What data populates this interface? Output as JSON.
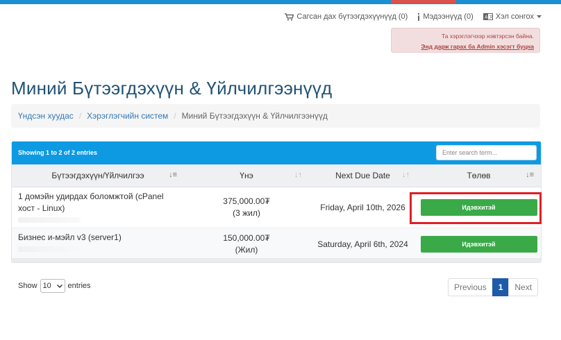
{
  "topnav": {
    "cart_label": "Сагсан дах бүтээгдэхүүнүүд (0)",
    "notifications_label": "Мэдээнүүд (0)",
    "language_label": "Хэл сонгох"
  },
  "admin_alert": {
    "message": "Та хэрэглэгчээр нэвтэрсэн байна.",
    "link": "Энд дарж гарах ба Admin хэсэгт буцна"
  },
  "page": {
    "title": "Миний Бүтээгдэхүүн & Үйлчилгээнүүд"
  },
  "breadcrumb": {
    "items": [
      "Үндсэн хуудас",
      "Хэрэглэгчийн систем",
      "Миний Бүтээгдэхүүн & Үйлчилгээнүүд"
    ]
  },
  "table": {
    "info": "Showing 1 to 2 of 2 entries",
    "search_placeholder": "Enter search term...",
    "headers": [
      "Бүтээгдэхүүн/Үйлчилгээ",
      "Үнэ",
      "Next Due Date",
      "Төлөв"
    ],
    "rows": [
      {
        "product": "1 домэйн удирдах боломжтой (cPanel хост - Linux)",
        "price": "375,000.00₮",
        "cycle": "(3 жил)",
        "due": "Friday, April 10th, 2026",
        "status": "Идэвхитэй"
      },
      {
        "product": "Бизнес и-мэйл v3 (server1)",
        "price": "150,000.00₮",
        "cycle": "(Жил)",
        "due": "Saturday, April 6th, 2024",
        "status": "Идэвхитэй"
      }
    ]
  },
  "footer": {
    "show_label": "Show",
    "entries_value": "10",
    "entries_label": "entries"
  },
  "pagination": {
    "previous": "Previous",
    "current": "1",
    "next": "Next"
  },
  "colors": {
    "topbar": "#1a8fd1",
    "title": "#215273",
    "status_active": "#3aaa48",
    "highlight": "#e01e26",
    "page_active": "#1d5aa8"
  }
}
